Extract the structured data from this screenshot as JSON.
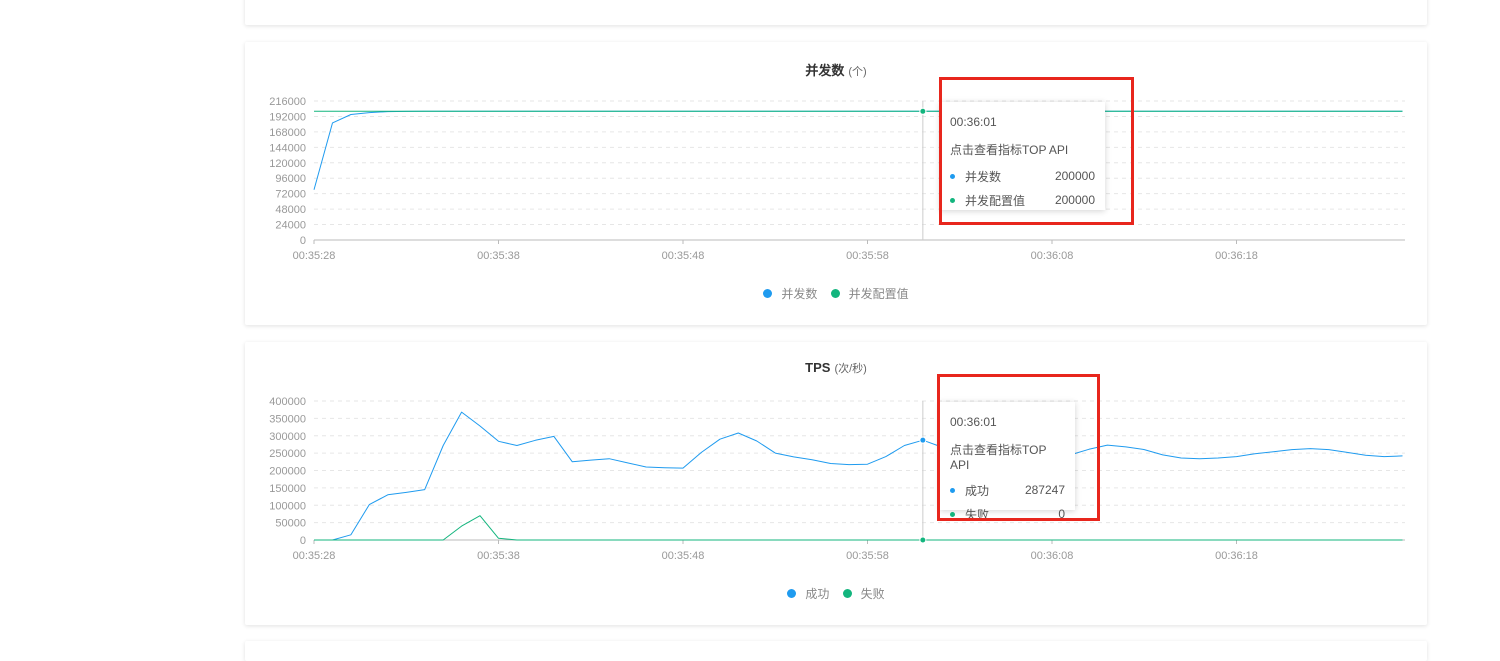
{
  "colors": {
    "blue": "#1f9bef",
    "green": "#13b57e",
    "highlight": "#e8261d"
  },
  "chart_data": [
    {
      "type": "line",
      "title": "并发数",
      "unit": "(个)",
      "x": [
        "00:35:28",
        "00:35:29",
        "00:35:30",
        "00:35:31",
        "00:35:32",
        "00:35:33",
        "00:35:34",
        "00:35:35",
        "00:35:36",
        "00:35:37",
        "00:35:38",
        "00:35:39",
        "00:35:40",
        "00:35:41",
        "00:35:42",
        "00:35:43",
        "00:35:44",
        "00:35:45",
        "00:35:46",
        "00:35:47",
        "00:35:48",
        "00:35:49",
        "00:35:50",
        "00:35:51",
        "00:35:52",
        "00:35:53",
        "00:35:54",
        "00:35:55",
        "00:35:56",
        "00:35:57",
        "00:35:58",
        "00:35:59",
        "00:36:00",
        "00:36:01",
        "00:36:02",
        "00:36:03",
        "00:36:04",
        "00:36:05",
        "00:36:06",
        "00:36:07",
        "00:36:08",
        "00:36:09",
        "00:36:10",
        "00:36:11",
        "00:36:12",
        "00:36:13",
        "00:36:14",
        "00:36:15",
        "00:36:16",
        "00:36:17",
        "00:36:18",
        "00:36:19",
        "00:36:20",
        "00:36:21",
        "00:36:22",
        "00:36:23",
        "00:36:24",
        "00:36:25",
        "00:36:26",
        "00:36:27"
      ],
      "x_ticks": [
        "00:35:28",
        "00:35:38",
        "00:35:48",
        "00:35:58",
        "00:36:08",
        "00:36:18"
      ],
      "y_ticks": [
        0,
        24000,
        48000,
        72000,
        96000,
        120000,
        144000,
        168000,
        192000,
        216000
      ],
      "ylim": [
        0,
        216000
      ],
      "series": [
        {
          "name": "并发数",
          "color": "#1f9bef",
          "values": [
            78000,
            182000,
            195000,
            198000,
            199500,
            199800,
            200000,
            200000,
            200000,
            200000,
            200000,
            200000,
            200000,
            200000,
            200000,
            200000,
            200000,
            200000,
            200000,
            200000,
            200000,
            200000,
            200000,
            200000,
            200000,
            200000,
            200000,
            200000,
            200000,
            200000,
            200000,
            200000,
            200000,
            200000,
            200000,
            200000,
            200000,
            200000,
            200000,
            200000,
            200000,
            200000,
            200000,
            200000,
            200000,
            200000,
            200000,
            200000,
            200000,
            200000,
            200000,
            200000,
            200000,
            200000,
            200000,
            200000,
            200000,
            200000,
            200000,
            200000
          ]
        },
        {
          "name": "并发配置值",
          "color": "#13b57e",
          "values": [
            200000,
            200000,
            200000,
            200000,
            200000,
            200000,
            200000,
            200000,
            200000,
            200000,
            200000,
            200000,
            200000,
            200000,
            200000,
            200000,
            200000,
            200000,
            200000,
            200000,
            200000,
            200000,
            200000,
            200000,
            200000,
            200000,
            200000,
            200000,
            200000,
            200000,
            200000,
            200000,
            200000,
            200000,
            200000,
            200000,
            200000,
            200000,
            200000,
            200000,
            200000,
            200000,
            200000,
            200000,
            200000,
            200000,
            200000,
            200000,
            200000,
            200000,
            200000,
            200000,
            200000,
            200000,
            200000,
            200000,
            200000,
            200000,
            200000,
            200000
          ]
        }
      ],
      "hover_x": "00:36:01",
      "tooltip": {
        "time": "00:36:01",
        "link": "点击查看指标TOP API",
        "rows": [
          {
            "name": "并发数",
            "value": "200000"
          },
          {
            "name": "并发配置值",
            "value": "200000"
          }
        ]
      },
      "legend": [
        "并发数",
        "并发配置值"
      ]
    },
    {
      "type": "line",
      "title": "TPS",
      "unit": "(次/秒)",
      "x": [
        "00:35:28",
        "00:35:29",
        "00:35:30",
        "00:35:31",
        "00:35:32",
        "00:35:33",
        "00:35:34",
        "00:35:35",
        "00:35:36",
        "00:35:37",
        "00:35:38",
        "00:35:39",
        "00:35:40",
        "00:35:41",
        "00:35:42",
        "00:35:43",
        "00:35:44",
        "00:35:45",
        "00:35:46",
        "00:35:47",
        "00:35:48",
        "00:35:49",
        "00:35:50",
        "00:35:51",
        "00:35:52",
        "00:35:53",
        "00:35:54",
        "00:35:55",
        "00:35:56",
        "00:35:57",
        "00:35:58",
        "00:35:59",
        "00:36:00",
        "00:36:01",
        "00:36:02",
        "00:36:03",
        "00:36:04",
        "00:36:05",
        "00:36:06",
        "00:36:07",
        "00:36:08",
        "00:36:09",
        "00:36:10",
        "00:36:11",
        "00:36:12",
        "00:36:13",
        "00:36:14",
        "00:36:15",
        "00:36:16",
        "00:36:17",
        "00:36:18",
        "00:36:19",
        "00:36:20",
        "00:36:21",
        "00:36:22",
        "00:36:23",
        "00:36:24",
        "00:36:25",
        "00:36:26",
        "00:36:27"
      ],
      "x_ticks": [
        "00:35:28",
        "00:35:38",
        "00:35:48",
        "00:35:58",
        "00:36:08",
        "00:36:18"
      ],
      "y_ticks": [
        0,
        50000,
        100000,
        150000,
        200000,
        250000,
        300000,
        350000,
        400000
      ],
      "ylim": [
        0,
        400000
      ],
      "series": [
        {
          "name": "成功",
          "color": "#1f9bef",
          "values": [
            0,
            0,
            15000,
            102000,
            130000,
            137000,
            145000,
            272000,
            368000,
            328000,
            284000,
            272000,
            287000,
            298000,
            225000,
            230000,
            234000,
            222000,
            210000,
            208000,
            207000,
            252000,
            290000,
            308000,
            285000,
            250000,
            239000,
            231000,
            220000,
            217000,
            218000,
            240000,
            272000,
            287247,
            268000,
            250000,
            230000,
            218000,
            213000,
            221000,
            232000,
            245000,
            261000,
            273000,
            268000,
            260000,
            245000,
            236000,
            234000,
            236000,
            240000,
            248000,
            254000,
            260000,
            263000,
            260000,
            252000,
            244000,
            240000,
            242000
          ]
        },
        {
          "name": "失败",
          "color": "#13b57e",
          "values": [
            0,
            0,
            0,
            0,
            0,
            0,
            0,
            0,
            40000,
            70000,
            5000,
            0,
            0,
            0,
            0,
            0,
            0,
            0,
            0,
            0,
            0,
            0,
            0,
            0,
            0,
            0,
            0,
            0,
            0,
            0,
            0,
            0,
            0,
            0,
            0,
            0,
            0,
            0,
            0,
            0,
            0,
            0,
            0,
            0,
            0,
            0,
            0,
            0,
            0,
            0,
            0,
            0,
            0,
            0,
            0,
            0,
            0,
            0,
            0,
            0
          ]
        }
      ],
      "hover_x": "00:36:01",
      "tooltip": {
        "time": "00:36:01",
        "link": "点击查看指标TOP API",
        "rows": [
          {
            "name": "成功",
            "value": "287247"
          },
          {
            "name": "失败",
            "value": "0"
          }
        ]
      },
      "legend": [
        "成功",
        "失败"
      ]
    }
  ]
}
